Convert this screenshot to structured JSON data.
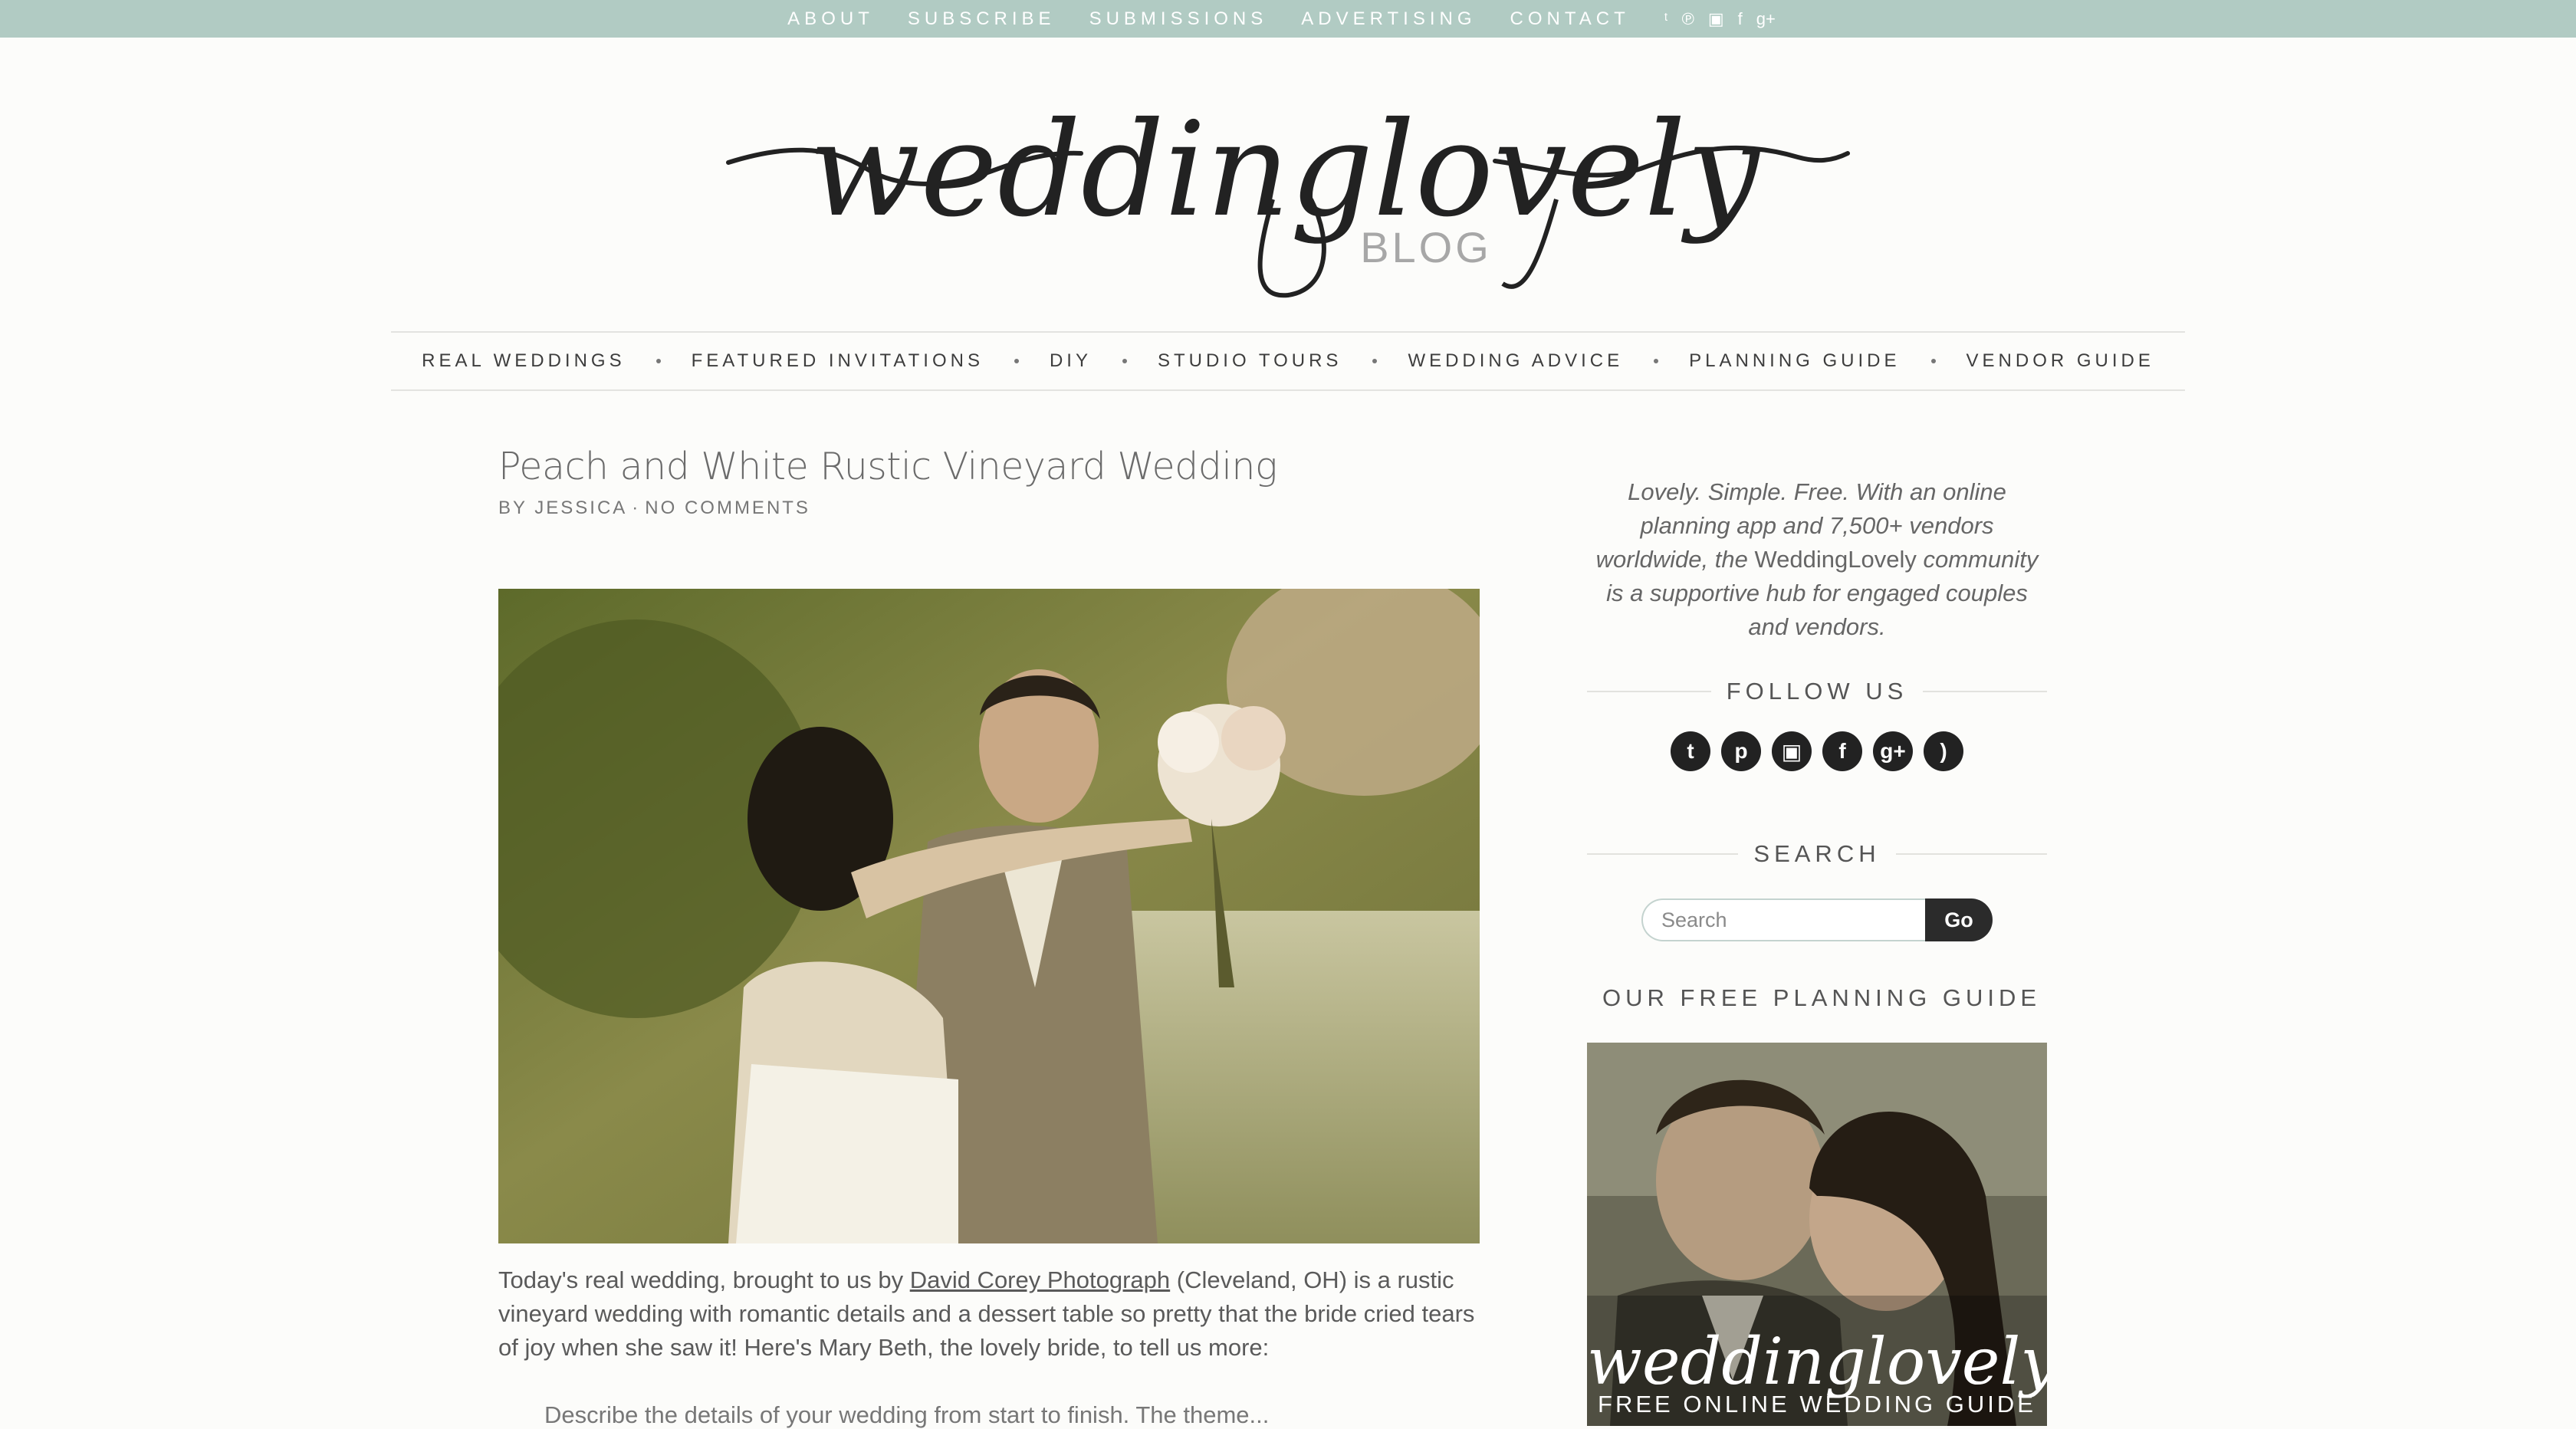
{
  "topbar": {
    "links": [
      "ABOUT",
      "SUBSCRIBE",
      "SUBMISSIONS",
      "ADVERTISING",
      "CONTACT"
    ],
    "social_icons": [
      "twitter-icon",
      "pinterest-icon",
      "instagram-icon",
      "facebook-icon",
      "google-plus-icon"
    ],
    "social_glyphs": [
      "ᵗ",
      "℗",
      "▣",
      "f",
      "g+"
    ],
    "bg_color": "#b1cbc3"
  },
  "logo": {
    "script": "weddinglovely",
    "sub": "BLOG"
  },
  "mainnav": {
    "items": [
      "REAL WEDDINGS",
      "FEATURED INVITATIONS",
      "DIY",
      "STUDIO TOURS",
      "WEDDING ADVICE",
      "PLANNING GUIDE",
      "VENDOR GUIDE"
    ]
  },
  "post": {
    "title": "Peach and White Rustic Vineyard Wedding",
    "author": "BY JESSICA",
    "meta_separator": "·",
    "comments": "NO COMMENTS",
    "body_before_link": "Today's real wedding, brought to us by ",
    "body_link": "David Corey Photograph",
    "body_after_link": " (Cleveland, OH) is a rustic vineyard wedding with romantic details and a dessert table so pretty that the bride cried tears of joy when she saw it! Here's Mary Beth, the lovely bride, to tell us more:",
    "next_line": "Describe the details of your wedding from start to finish. The theme..."
  },
  "sidebar": {
    "tagline_before": "Lovely. Simple. Free. With an online planning app and 7,500+ vendors worldwide, the ",
    "tagline_brand": "WeddingLovely",
    "tagline_after": " community is a supportive hub for engaged couples and vendors.",
    "follow_heading": "FOLLOW US",
    "follow_icons": [
      "twitter-icon",
      "pinterest-icon",
      "instagram-icon",
      "facebook-icon",
      "google-plus-icon",
      "rss-icon"
    ],
    "follow_glyphs": [
      "t",
      "p",
      "▣",
      "f",
      "g+",
      ")"
    ],
    "search_heading": "SEARCH",
    "search_placeholder": "Search",
    "search_button": "Go",
    "guide_heading": "OUR FREE PLANNING GUIDE",
    "guide_script": "weddinglovely",
    "guide_caption": "FREE ONLINE WEDDING GUIDE"
  }
}
